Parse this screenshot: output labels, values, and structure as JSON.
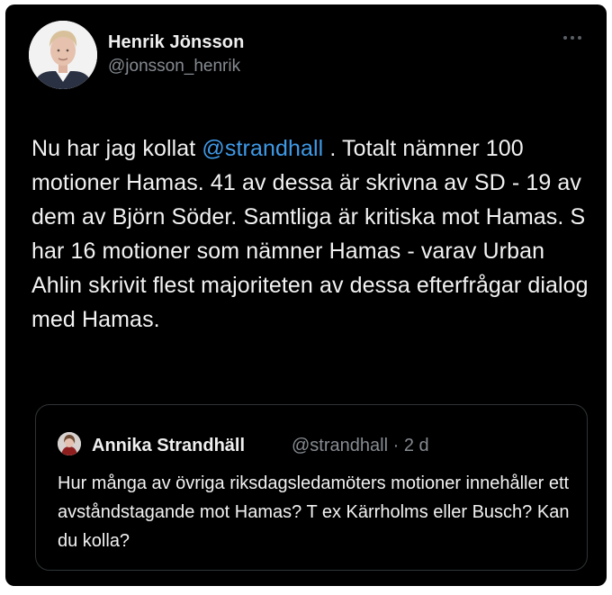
{
  "tweet": {
    "author": {
      "name": "Henrik Jönsson",
      "handle": "@jonsson_henrik",
      "avatar_icon": "profile-photo"
    },
    "more_icon": "ellipsis-icon",
    "text": {
      "prefix": "Nu har jag kollat ",
      "mention": "@strandhall",
      "suffix": " . Totalt nämner 100 motioner Hamas. 41 av dessa är skrivna av SD - 19 av dem av Björn Söder. Samtliga är kritiska mot Hamas. S har 16 motioner som nämner Hamas - varav Urban Ahlin skrivit flest majoriteten av dessa efterfrågar dialog med Hamas."
    }
  },
  "quote": {
    "author": {
      "name": "Annika Strandhäll",
      "handle": "@strandhall",
      "separator": "·",
      "time": "2 d",
      "avatar_icon": "profile-photo"
    },
    "text": "Hur många av övriga riksdagsledamöters motioner innehåller ett avståndstagande mot Hamas? T ex Kärrholms eller Busch? Kan du kolla?"
  },
  "colors": {
    "background": "#000000",
    "text": "#f2f2f2",
    "muted": "#868b91",
    "link": "#3f9ae8",
    "border": "#2f3336"
  }
}
